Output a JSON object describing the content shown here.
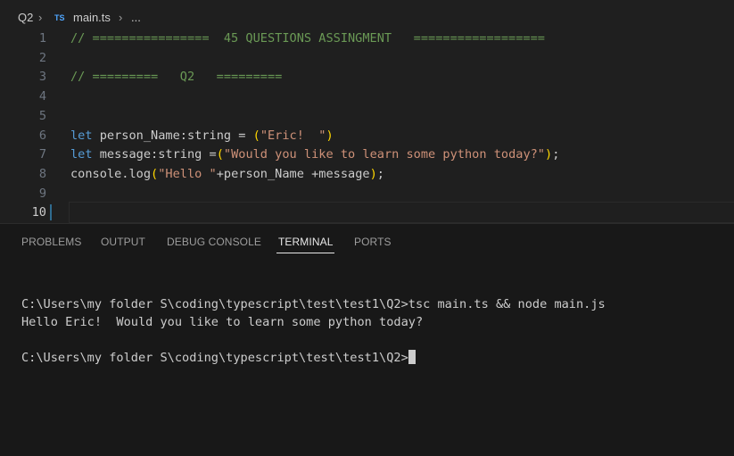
{
  "breadcrumb": {
    "folder": "Q2",
    "sep1": "›",
    "file_badge": "TS",
    "file": "main.ts",
    "sep2": "›",
    "more": "..."
  },
  "editor": {
    "lines": [
      {
        "num": "1",
        "segments": [
          {
            "cls": "c-comment",
            "text": "// ================  45 QUESTIONS ASSINGMENT   =================="
          }
        ]
      },
      {
        "num": "2",
        "segments": []
      },
      {
        "num": "3",
        "segments": [
          {
            "cls": "c-comment",
            "text": "// =========   Q2   ========="
          }
        ]
      },
      {
        "num": "4",
        "segments": []
      },
      {
        "num": "5",
        "segments": []
      },
      {
        "num": "6",
        "segments": [
          {
            "cls": "c-kw",
            "text": "let"
          },
          {
            "cls": "c-punc",
            "text": " person_Name:string = "
          },
          {
            "cls": "c-paren",
            "text": "("
          },
          {
            "cls": "c-str",
            "text": "\"Eric!  \""
          },
          {
            "cls": "c-paren",
            "text": ")"
          }
        ]
      },
      {
        "num": "7",
        "segments": [
          {
            "cls": "c-kw",
            "text": "let"
          },
          {
            "cls": "c-punc",
            "text": " message:string ="
          },
          {
            "cls": "c-paren",
            "text": "("
          },
          {
            "cls": "c-str",
            "text": "\"Would you like to learn some python today?\""
          },
          {
            "cls": "c-paren",
            "text": ")"
          },
          {
            "cls": "c-punc",
            "text": ";"
          }
        ]
      },
      {
        "num": "8",
        "segments": [
          {
            "cls": "c-punc",
            "text": "console.log"
          },
          {
            "cls": "c-paren",
            "text": "("
          },
          {
            "cls": "c-str",
            "text": "\"Hello \""
          },
          {
            "cls": "c-punc",
            "text": "+person_Name +message"
          },
          {
            "cls": "c-paren",
            "text": ")"
          },
          {
            "cls": "c-punc",
            "text": ";"
          }
        ]
      },
      {
        "num": "9",
        "segments": []
      },
      {
        "num": "10",
        "segments": [],
        "current": true
      }
    ]
  },
  "panel": {
    "tabs": [
      "PROBLEMS",
      "OUTPUT",
      "DEBUG CONSOLE",
      "TERMINAL",
      "PORTS"
    ],
    "active_tab": "TERMINAL"
  },
  "terminal": {
    "lines": [
      "C:\\Users\\my folder S\\coding\\typescript\\test\\test1\\Q2>tsc main.ts && node main.js",
      "Hello Eric!  Would you like to learn some python today?",
      "",
      "C:\\Users\\my folder S\\coding\\typescript\\test\\test1\\Q2>"
    ]
  }
}
